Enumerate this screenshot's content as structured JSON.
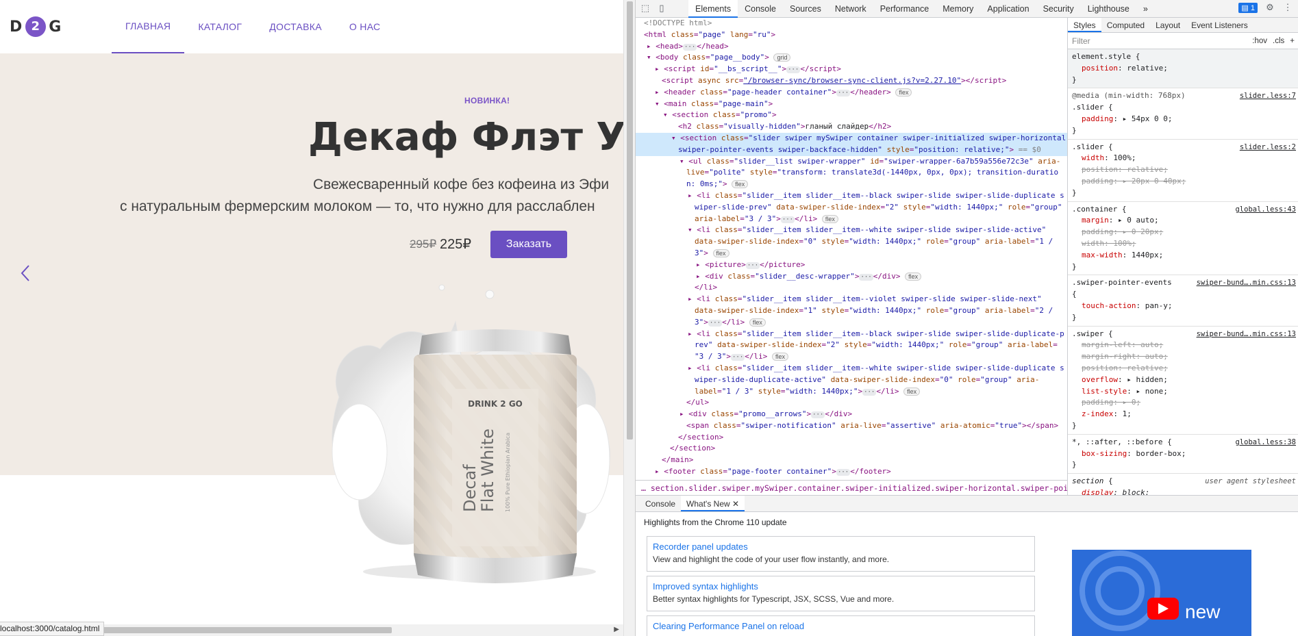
{
  "page": {
    "nav": [
      {
        "label": "ГЛАВНАЯ"
      },
      {
        "label": "КАТАЛОГ"
      },
      {
        "label": "ДОСТАВКА"
      },
      {
        "label": "О НАС"
      }
    ],
    "logo": {
      "left": "D",
      "middle": "2",
      "right": "G"
    },
    "hero": {
      "badge": "НОВИНКА!",
      "title": "Декаф Флэт Уа",
      "desc_line1": "Свежесваренный кофе без кофеина из Эфи",
      "desc_line2": "с натуральным фермерским молоком — то, что нужно для расслаблен",
      "price_old": "295₽",
      "price_new": "225₽",
      "order_label": "Заказать"
    },
    "can": {
      "brand": "DRINK 2 GO",
      "name1": "Decaf",
      "name2": "Flat White",
      "subtitle": "100% Pure Ethiopian Arabica"
    },
    "status_url": "localhost:3000/catalog.html"
  },
  "devtools": {
    "tabs": [
      "Elements",
      "Console",
      "Sources",
      "Network",
      "Performance",
      "Memory",
      "Application",
      "Security",
      "Lighthouse"
    ],
    "active_tab": "Elements",
    "message_count": "1",
    "styles_tabs": [
      "Styles",
      "Computed",
      "Layout",
      "Event Listeners"
    ],
    "filter_placeholder": "Filter",
    "filter_tools": [
      ":hov",
      ".cls",
      "+"
    ],
    "breadcrumb": "section.slider.swiper.mySwiper.container.swiper-initialized.swiper-horizontal.swiper-pointer-events.swiper-bac",
    "drawer_tabs": [
      "Console",
      "What's New"
    ],
    "drawer_heading": "Highlights from the Chrome 110 update",
    "cards": [
      {
        "title": "Recorder panel updates",
        "desc": "View and highlight the code of your user flow instantly, and more."
      },
      {
        "title": "Improved syntax highlights",
        "desc": "Better syntax highlights for Typescript, JSX, SCSS, Vue and more."
      },
      {
        "title": "Clearing Performance Panel on reload",
        "desc": ""
      }
    ],
    "promo_text": "new"
  }
}
